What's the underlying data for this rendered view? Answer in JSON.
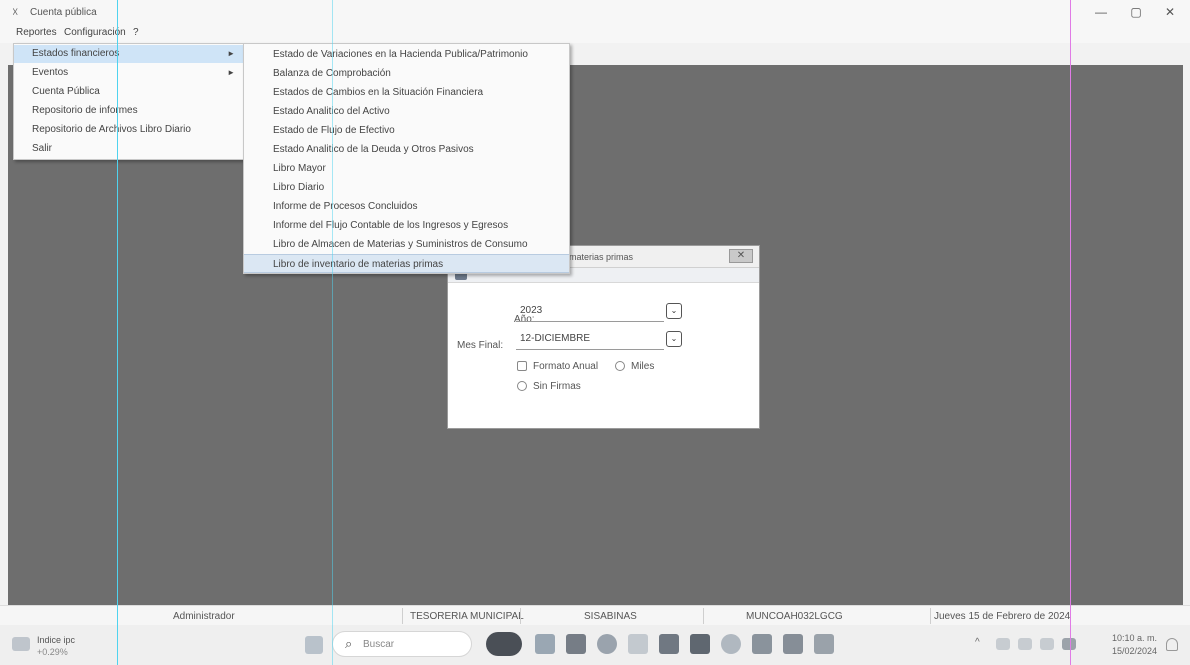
{
  "window": {
    "title": "Cuenta pública",
    "minimize": "—",
    "maximize": "▢",
    "close": "✕"
  },
  "menubar": {
    "items": [
      "Reportes",
      "Configuración",
      "?"
    ]
  },
  "menu_reportes": {
    "items": [
      {
        "label": "Estados financieros",
        "submenu": true,
        "highlighted": true
      },
      {
        "label": "Eventos",
        "submenu": true
      },
      {
        "label": "Cuenta Pública"
      },
      {
        "label": "Repositorio de informes"
      },
      {
        "label": "Repositorio de Archivos Libro Diario"
      },
      {
        "label": "Salir"
      }
    ]
  },
  "submenu_estados": {
    "items": [
      "Estado de Variaciones en la Hacienda Publica/Patrimonio",
      "Balanza de Comprobación",
      "Estados de Cambios en la Situación Financiera",
      "Estado Analitico del Activo",
      "Estado de Flujo de Efectivo",
      "Estado Analitico de la Deuda y Otros Pasivos",
      "Libro Mayor",
      "Libro Diario",
      "Informe de Procesos Concluidos",
      "Informe del Flujo Contable de los Ingresos y Egresos",
      "Libro de Almacen de Materias y Suministros de Consumo",
      "Libro de inventario de materias primas"
    ],
    "highlighted_index": 11
  },
  "dialog": {
    "title": "materias primas",
    "close_label": "✕",
    "anio_label": "Año:",
    "anio_value": "2023",
    "mes_label": "Mes Final:",
    "mes_value": "12-DICIEMBRE",
    "dropdown_glyph": "⌄",
    "formato_anual": "Formato Anual",
    "miles": "Miles",
    "sin_firmas": "Sin Firmas"
  },
  "statusbar": {
    "user": "Administrador",
    "department": "TESORERIA MUNICIPAL",
    "database": "SISABINAS",
    "machine": "MUNCOAH032LGCG",
    "date": "Jueves 15 de Febrero de 2024"
  },
  "taskbar": {
    "weather_title": "Indice ipc",
    "weather_value": "+0.29%",
    "search_placeholder": "Buscar",
    "search_glyph": "⌕",
    "time": "10:10 a. m.",
    "date": "15/02/2024",
    "tray_chevron": "^"
  },
  "colors": {
    "workspace": "#6e6e6e",
    "menu_highlight": "#cfe4f7",
    "guide_cyan": "#4fd3ef",
    "guide_magenta": "#e07be6"
  }
}
